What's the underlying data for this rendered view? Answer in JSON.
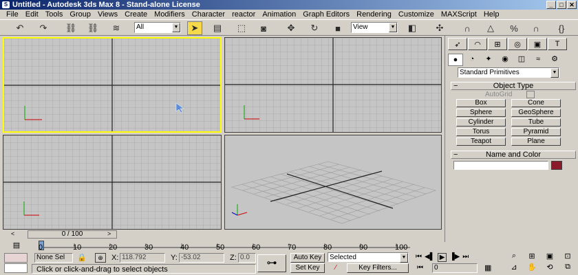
{
  "window": {
    "title": "Untitled - Autodesk 3ds Max 8 - Stand-alone License",
    "minimize": "_",
    "maximize": "□",
    "close": "✕"
  },
  "menu": [
    "File",
    "Edit",
    "Tools",
    "Group",
    "Views",
    "Create",
    "Modifiers",
    "Character",
    "reactor",
    "Animation",
    "Graph Editors",
    "Rendering",
    "Customize",
    "MAXScript",
    "Help"
  ],
  "toolbar": {
    "selection_filter": "All",
    "reference_coord": "View"
  },
  "create_panel": {
    "category": "Standard Primitives",
    "object_type_header": "Object Type",
    "autogrid_label": "AutoGrid",
    "objects": [
      "Box",
      "Cone",
      "Sphere",
      "GeoSphere",
      "Cylinder",
      "Tube",
      "Torus",
      "Pyramid",
      "Teapot",
      "Plane"
    ],
    "name_color_header": "Name and Color",
    "object_color": "#8b1a2b"
  },
  "timeline": {
    "frame_display": "0 / 100",
    "prev": "<",
    "next": ">",
    "ticks": [
      "0",
      "10",
      "20",
      "30",
      "40",
      "50",
      "60",
      "70",
      "80",
      "90",
      "100"
    ]
  },
  "status": {
    "selection": "None Sel",
    "x_label": "X:",
    "x_value": "118.792",
    "y_label": "Y:",
    "y_value": "-53.02",
    "z_label": "Z:",
    "z_value": "0.0",
    "prompt": "Click or click-and-drag to select objects",
    "auto_key": "Auto Key",
    "set_key": "Set Key",
    "key_mode": "Selected",
    "key_filters": "Key Filters...",
    "frame": "0"
  },
  "colors": {
    "active_viewport": "#ffff00",
    "title_start": "#0a246a",
    "title_end": "#a6caf0"
  }
}
